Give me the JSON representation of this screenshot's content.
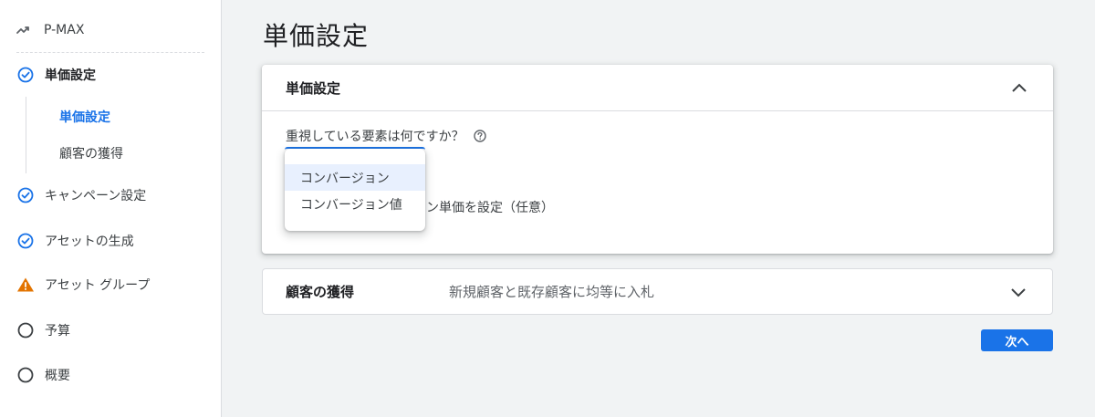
{
  "sidebar": {
    "campaign_label": "P-MAX",
    "items": [
      {
        "label": "単価設定",
        "status": "check",
        "icon": "check-circle-icon"
      },
      {
        "label": "キャンペーン設定",
        "status": "check",
        "icon": "check-circle-icon"
      },
      {
        "label": "アセットの生成",
        "status": "check",
        "icon": "check-circle-icon"
      },
      {
        "label": "アセット グループ",
        "status": "warning",
        "icon": "warning-icon"
      },
      {
        "label": "予算",
        "status": "empty",
        "icon": "empty-circle-icon"
      },
      {
        "label": "概要",
        "status": "empty",
        "icon": "empty-circle-icon"
      }
    ],
    "subitems": [
      {
        "label": "単価設定",
        "active": true
      },
      {
        "label": "顧客の獲得",
        "active": false
      }
    ]
  },
  "main": {
    "page_title": "単価設定",
    "bidding_card": {
      "title": "単価設定",
      "question": "重視している要素は何ですか？",
      "dropdown_options": [
        "コンバージョン",
        "コンバージョン値"
      ],
      "partial_option_text": "ン単価を設定（任意）"
    },
    "acquisition_card": {
      "title": "顧客の獲得",
      "summary": "新規顧客と既存顧客に均等に入札"
    },
    "next_label": "次へ"
  },
  "colors": {
    "accent": "#1a73e8",
    "warning": "#e37400",
    "menu_hover": "#e8f0fe"
  }
}
